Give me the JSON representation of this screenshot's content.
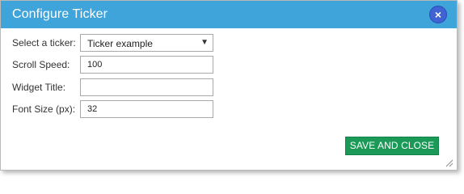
{
  "dialog": {
    "title": "Configure Ticker",
    "close_label": "×",
    "colors": {
      "titlebar": "#3fa4da",
      "close_button": "#3f63d2",
      "save_button": "#1b9a57"
    }
  },
  "form": {
    "ticker": {
      "label": "Select a ticker:",
      "value": "Ticker example",
      "arrow": "▼"
    },
    "scroll_speed": {
      "label": "Scroll Speed:",
      "value": "100"
    },
    "widget_title": {
      "label": "Widget Title:",
      "value": ""
    },
    "font_size": {
      "label": "Font Size (px):",
      "value": "32"
    }
  },
  "footer": {
    "save_label": "SAVE AND CLOSE"
  }
}
